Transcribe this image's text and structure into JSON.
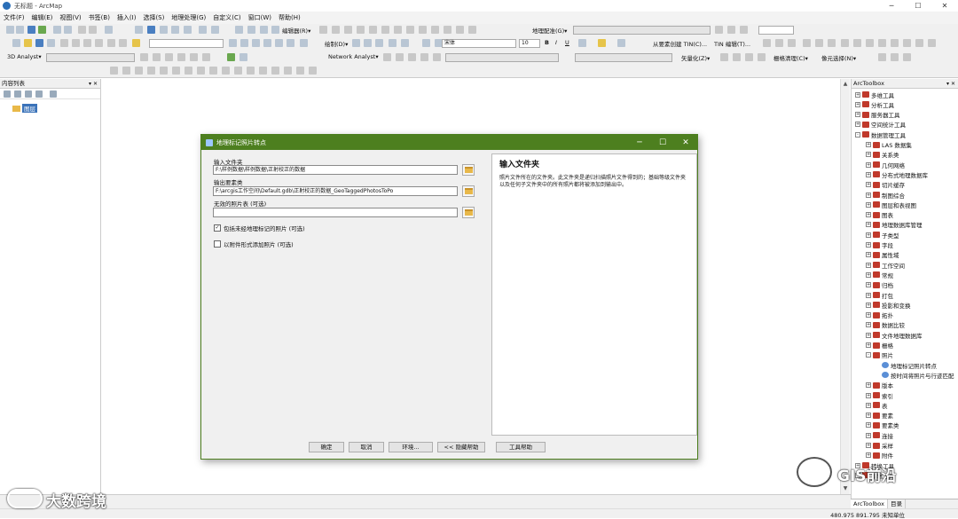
{
  "app": {
    "title": "无标题 - ArcMap"
  },
  "menubar": [
    "文件(F)",
    "编辑(E)",
    "视图(V)",
    "书签(B)",
    "插入(I)",
    "选择(S)",
    "地理处理(G)",
    "自定义(C)",
    "窗口(W)",
    "帮助(H)"
  ],
  "toolbar": {
    "georef_label": "地理配准(G)▾",
    "editor_label": "编辑器(R)▾",
    "draw_label": "绘制(D)▾",
    "font_name": "宋体",
    "font_size": "10",
    "analyst3d_label": "3D Analyst▾",
    "network_label": "Network Analyst▾",
    "create_tin_label": "从要素创建 TIN(C)...",
    "tin_edit_label": "TIN 编辑(T)...",
    "vectorize_label": "矢量化(Z)▾",
    "raster_clean_label": "栅格清理(C)▾",
    "image_classify_label": "像元选择(N)▾"
  },
  "toc": {
    "title": "内容列表",
    "layer": "图层"
  },
  "arctoolbox": {
    "title": "ArcToolbox",
    "items": [
      {
        "label": "多维工具",
        "level": 1,
        "exp": "+"
      },
      {
        "label": "分析工具",
        "level": 1,
        "exp": "+"
      },
      {
        "label": "服务器工具",
        "level": 1,
        "exp": "+"
      },
      {
        "label": "空间统计工具",
        "level": 1,
        "exp": "+"
      },
      {
        "label": "数据管理工具",
        "level": 1,
        "exp": "-"
      },
      {
        "label": "LAS 数据集",
        "level": 2,
        "exp": "+"
      },
      {
        "label": "关系类",
        "level": 2,
        "exp": "+"
      },
      {
        "label": "几何网络",
        "level": 2,
        "exp": "+"
      },
      {
        "label": "分布式地理数据库",
        "level": 2,
        "exp": "+"
      },
      {
        "label": "切片缓存",
        "level": 2,
        "exp": "+"
      },
      {
        "label": "制图综合",
        "level": 2,
        "exp": "+"
      },
      {
        "label": "图层和表视图",
        "level": 2,
        "exp": "+"
      },
      {
        "label": "图表",
        "level": 2,
        "exp": "+"
      },
      {
        "label": "地理数据库管理",
        "level": 2,
        "exp": "+"
      },
      {
        "label": "子类型",
        "level": 2,
        "exp": "+"
      },
      {
        "label": "字段",
        "level": 2,
        "exp": "+"
      },
      {
        "label": "属性域",
        "level": 2,
        "exp": "+"
      },
      {
        "label": "工作空间",
        "level": 2,
        "exp": "+"
      },
      {
        "label": "常规",
        "level": 2,
        "exp": "+"
      },
      {
        "label": "归档",
        "level": 2,
        "exp": "+"
      },
      {
        "label": "打包",
        "level": 2,
        "exp": "+"
      },
      {
        "label": "投影和变换",
        "level": 2,
        "exp": "+"
      },
      {
        "label": "拓扑",
        "level": 2,
        "exp": "+"
      },
      {
        "label": "数据比较",
        "level": 2,
        "exp": "+"
      },
      {
        "label": "文件地理数据库",
        "level": 2,
        "exp": "+"
      },
      {
        "label": "栅格",
        "level": 2,
        "exp": "+"
      },
      {
        "label": "照片",
        "level": 2,
        "exp": "-"
      },
      {
        "label": "地理标记照片转点",
        "level": 3,
        "exp": ""
      },
      {
        "label": "按时间将照片与行迹匹配",
        "level": 3,
        "exp": ""
      },
      {
        "label": "版本",
        "level": 2,
        "exp": "+"
      },
      {
        "label": "索引",
        "level": 2,
        "exp": "+"
      },
      {
        "label": "表",
        "level": 2,
        "exp": "+"
      },
      {
        "label": "要素",
        "level": 2,
        "exp": "+"
      },
      {
        "label": "要素类",
        "level": 2,
        "exp": "+"
      },
      {
        "label": "连接",
        "level": 2,
        "exp": "+"
      },
      {
        "label": "采样",
        "level": 2,
        "exp": "+"
      },
      {
        "label": "附件",
        "level": 2,
        "exp": "+"
      },
      {
        "label": "转换工具",
        "level": 1,
        "exp": "+"
      },
      {
        "label": "编辑工具",
        "level": 1,
        "exp": "+"
      }
    ],
    "tab_toolbox": "ArcToolbox",
    "tab_catalog": "目录"
  },
  "dialog": {
    "title": "地理标记照片转点",
    "input_folder_label": "输入文件夹",
    "input_folder_value": "F:\\样例数据\\样例数据\\正射校正的数据",
    "output_fc_label": "输出要素类",
    "output_fc_value": "F:\\arcgis工作空间\\Default.gdb\\正射校正的数据_GeoTaggedPhotosToPo",
    "invalid_table_label": "无效的照片表 (可选)",
    "invalid_table_value": "",
    "include_non_geotagged_label": "包括未经地理标记的照片 (可选)",
    "include_non_geotagged_checked": true,
    "add_as_attachments_label": "以附件形式添加照片 (可选)",
    "add_as_attachments_checked": false,
    "help_title": "输入文件夹",
    "help_body": "照片文件所在的文件夹。此文件夹是递归扫描照片文件得到的；基础等级文件夹以及任何子文件夹中的所有照片都将被添加到输出中。",
    "buttons": {
      "ok": "确定",
      "cancel": "取消",
      "env": "环境...",
      "hide_help": "<< 隐藏帮助",
      "tool_help": "工具帮助"
    }
  },
  "status": {
    "coords": "480.975  891.795 未知单位"
  },
  "watermarks": {
    "left": "大数跨境",
    "right": "GIS前沿"
  }
}
